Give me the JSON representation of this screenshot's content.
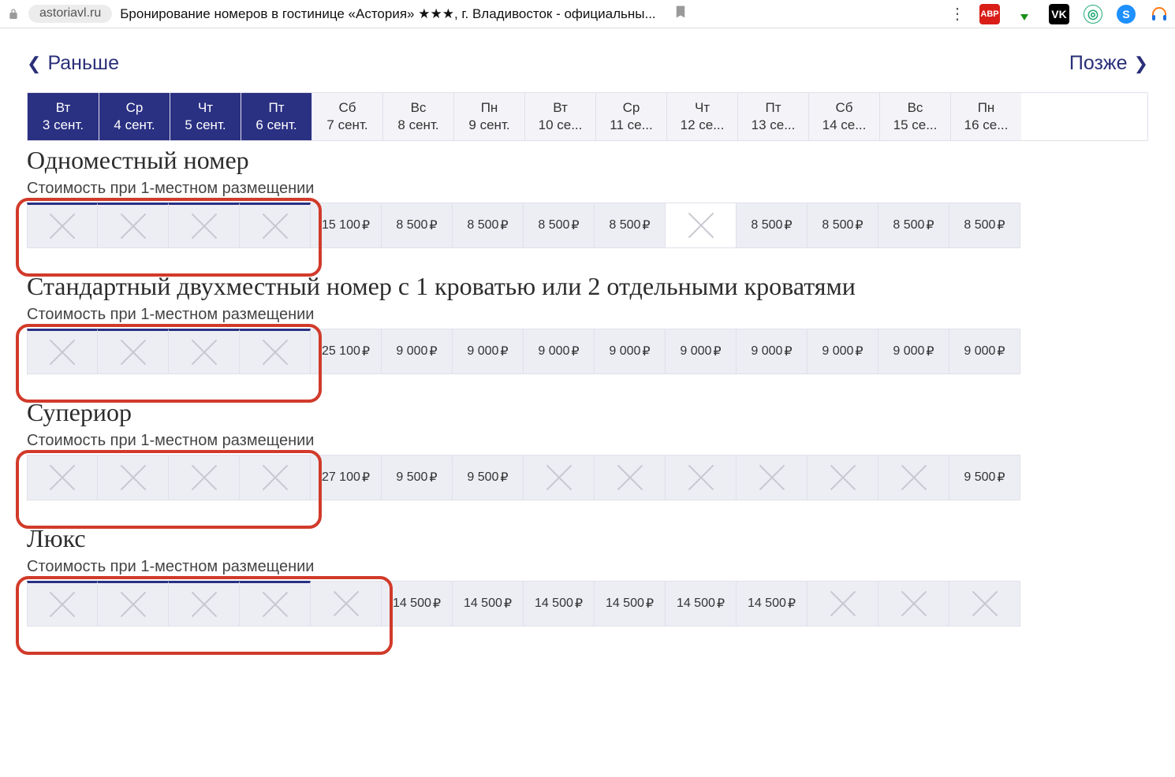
{
  "chrome": {
    "domain": "astoriavl.ru",
    "title": "Бронирование номеров в гостинице «Астория» ★★★, г. Владивосток - официальны..."
  },
  "nav": {
    "prev": "Раньше",
    "next": "Позже"
  },
  "currency": "₽",
  "dates": [
    {
      "dow": "Вт",
      "label": "3 сент.",
      "selected": true
    },
    {
      "dow": "Ср",
      "label": "4 сент.",
      "selected": true
    },
    {
      "dow": "Чт",
      "label": "5 сент.",
      "selected": true
    },
    {
      "dow": "Пт",
      "label": "6 сент.",
      "selected": true
    },
    {
      "dow": "Сб",
      "label": "7 сент.",
      "selected": false
    },
    {
      "dow": "Вс",
      "label": "8 сент.",
      "selected": false
    },
    {
      "dow": "Пн",
      "label": "9 сент.",
      "selected": false
    },
    {
      "dow": "Вт",
      "label": "10 се...",
      "selected": false
    },
    {
      "dow": "Ср",
      "label": "11 се...",
      "selected": false
    },
    {
      "dow": "Чт",
      "label": "12 се...",
      "selected": false
    },
    {
      "dow": "Пт",
      "label": "13 се...",
      "selected": false
    },
    {
      "dow": "Сб",
      "label": "14 се...",
      "selected": false
    },
    {
      "dow": "Вс",
      "label": "15 се...",
      "selected": false
    },
    {
      "dow": "Пн",
      "label": "16 се...",
      "selected": false
    }
  ],
  "rooms": [
    {
      "title": "Одноместный номер",
      "sub": "Стоимость при 1-местном размещении",
      "highlight_count": 4,
      "sel_top": true,
      "cells": [
        {
          "na": true
        },
        {
          "na": true
        },
        {
          "na": true
        },
        {
          "na": true
        },
        {
          "price": "15 100"
        },
        {
          "price": "8 500"
        },
        {
          "price": "8 500"
        },
        {
          "price": "8 500"
        },
        {
          "price": "8 500"
        },
        {
          "na": true,
          "white": true
        },
        {
          "price": "8 500"
        },
        {
          "price": "8 500"
        },
        {
          "price": "8 500"
        },
        {
          "price": "8 500"
        }
      ]
    },
    {
      "title": "Стандартный двухместный номер с 1 кроватью или 2 отдельными кроватями",
      "sub": "Стоимость при 1-местном размещении",
      "highlight_count": 4,
      "sel_top": true,
      "cells": [
        {
          "na": true
        },
        {
          "na": true
        },
        {
          "na": true
        },
        {
          "na": true
        },
        {
          "price": "25 100"
        },
        {
          "price": "9 000"
        },
        {
          "price": "9 000"
        },
        {
          "price": "9 000"
        },
        {
          "price": "9 000"
        },
        {
          "price": "9 000"
        },
        {
          "price": "9 000"
        },
        {
          "price": "9 000"
        },
        {
          "price": "9 000"
        },
        {
          "price": "9 000"
        }
      ]
    },
    {
      "title": "Супериор",
      "sub": "Стоимость при 1-местном размещении",
      "highlight_count": 4,
      "sel_top": false,
      "cells": [
        {
          "na": true
        },
        {
          "na": true
        },
        {
          "na": true
        },
        {
          "na": true
        },
        {
          "price": "27 100"
        },
        {
          "price": "9 500"
        },
        {
          "price": "9 500"
        },
        {
          "na": true
        },
        {
          "na": true
        },
        {
          "na": true
        },
        {
          "na": true
        },
        {
          "na": true
        },
        {
          "na": true
        },
        {
          "price": "9 500"
        }
      ]
    },
    {
      "title": "Люкс",
      "sub": "Стоимость при 1-местном размещении",
      "highlight_count": 5,
      "sel_top": true,
      "cells": [
        {
          "na": true
        },
        {
          "na": true
        },
        {
          "na": true
        },
        {
          "na": true
        },
        {
          "na": true
        },
        {
          "price": "14 500"
        },
        {
          "price": "14 500"
        },
        {
          "price": "14 500"
        },
        {
          "price": "14 500"
        },
        {
          "price": "14 500"
        },
        {
          "price": "14 500"
        },
        {
          "na": true
        },
        {
          "na": true
        },
        {
          "na": true
        }
      ]
    }
  ]
}
